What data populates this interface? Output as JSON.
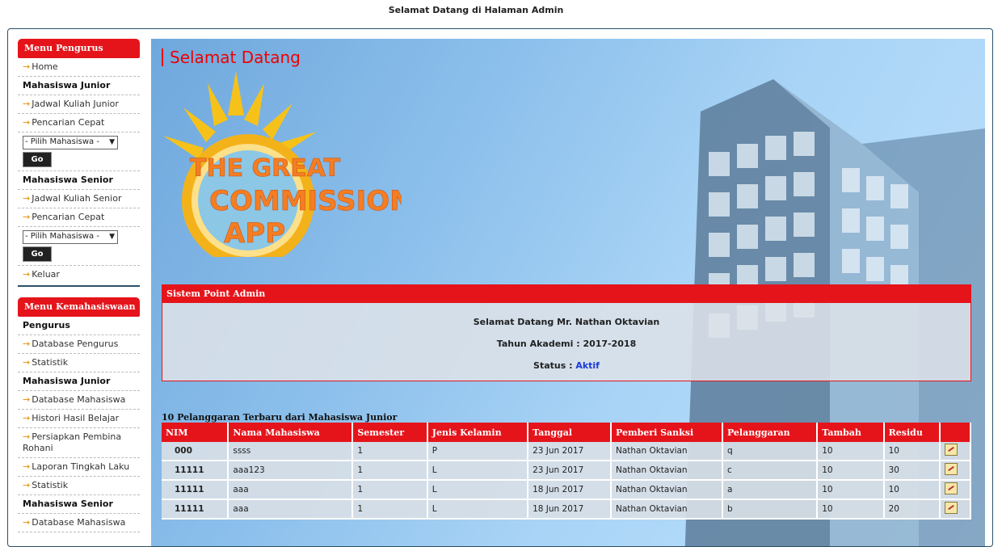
{
  "page": {
    "header": "Selamat Datang di Halaman Admin"
  },
  "sidebar": {
    "menu1": {
      "title": "Menu Pengurus",
      "home": "Home",
      "junior_section": "Mahasiswa Junior",
      "junior_jadwal": "Jadwal Kuliah Junior",
      "junior_cari": "Pencarian Cepat",
      "junior_select": "- Pilih Mahasiswa -",
      "go": "Go",
      "senior_section": "Mahasiswa Senior",
      "senior_jadwal": "Jadwal Kuliah Senior",
      "senior_cari": "Pencarian Cepat",
      "senior_select": "- Pilih Mahasiswa -",
      "keluar": "Keluar"
    },
    "menu2": {
      "title": "Menu Kemahasiswaan",
      "pengurus_section": "Pengurus",
      "db_pengurus": "Database Pengurus",
      "statistik1": "Statistik",
      "junior_section": "Mahasiswa Junior",
      "db_mahasiswa": "Database Mahasiswa",
      "histori": "Histori Hasil Belajar",
      "persiapkan": "Persiapkan Pembina Rohani",
      "laporan": "Laporan Tingkah Laku",
      "statistik2": "Statistik",
      "senior_section": "Mahasiswa Senior",
      "db_mahasiswa_senior": "Database Mahasiswa"
    }
  },
  "main": {
    "title": "Selamat Datang",
    "logo": {
      "line1": "THE GREAT",
      "line2": "COMMISSION",
      "line3": "APP"
    },
    "panel": {
      "title": "Sistem Point Admin",
      "greeting": "Selamat Datang Mr. Nathan Oktavian",
      "tahun": "Tahun Akademi : 2017-2018",
      "status_label": "Status :",
      "status_value": "Aktif"
    },
    "table": {
      "caption": "10 Pelanggaran Terbaru dari Mahasiswa Junior",
      "headers": [
        "NIM",
        "Nama Mahasiswa",
        "Semester",
        "Jenis Kelamin",
        "Tanggal",
        "Pemberi Sanksi",
        "Pelanggaran",
        "Tambah",
        "Residu"
      ],
      "rows": [
        [
          "000",
          "ssss",
          "1",
          "P",
          "23 Jun 2017",
          "Nathan Oktavian",
          "q",
          "10",
          "10"
        ],
        [
          "11111",
          "aaa123",
          "1",
          "L",
          "23 Jun 2017",
          "Nathan Oktavian",
          "c",
          "10",
          "30"
        ],
        [
          "11111",
          "aaa",
          "1",
          "L",
          "18 Jun 2017",
          "Nathan Oktavian",
          "a",
          "10",
          "10"
        ],
        [
          "11111",
          "aaa",
          "1",
          "L",
          "18 Jun 2017",
          "Nathan Oktavian",
          "b",
          "10",
          "20"
        ]
      ]
    }
  },
  "colors": {
    "accent_red": "#e5141b",
    "status_blue": "#1a3bd6",
    "frame_border": "#2b5066"
  },
  "icons": {
    "menu_arrow": "arrow-right-icon",
    "row_action": "edit-icon"
  }
}
